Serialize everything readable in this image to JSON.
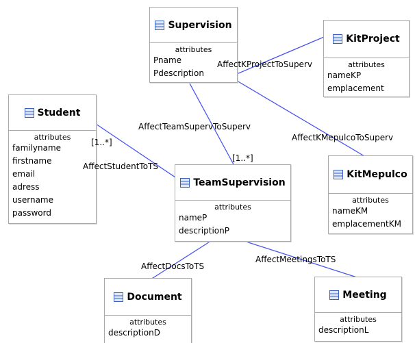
{
  "section_label": "attributes",
  "classes": {
    "supervision": {
      "name": "Supervision",
      "attributes": [
        "Pname",
        "Pdescription"
      ]
    },
    "kitproject": {
      "name": "KitProject",
      "attributes": [
        "nameKP",
        "emplacement"
      ]
    },
    "student": {
      "name": "Student",
      "attributes": [
        "familyname",
        "firstname",
        "email",
        "adress",
        "username",
        "password"
      ]
    },
    "teamsupervision": {
      "name": "TeamSupervision",
      "attributes": [
        "nameP",
        "descriptionP"
      ]
    },
    "kitmepulco": {
      "name": "KitMepulco",
      "attributes": [
        "nameKM",
        "emplacementKM"
      ]
    },
    "document": {
      "name": "Document",
      "attributes": [
        "descriptionD"
      ]
    },
    "meeting": {
      "name": "Meeting",
      "attributes": [
        "descriptionL"
      ]
    }
  },
  "associations": {
    "kitproject_to_superv": "AffectKProjectToSuperv",
    "teamsuperv_to_superv": "AffectTeamSupervToSuperv",
    "kitmepulco_to_superv": "AffectKMepulcoToSuperv",
    "student_to_ts": "AffectStudentToTS",
    "docs_to_ts": "AffectDocsToTS",
    "meetings_to_ts": "AffectMeetingsToTS"
  },
  "multiplicities": {
    "student_end": "[1..*]",
    "teamsupervision_end": "[1..*]"
  },
  "colors": {
    "link": "#4a55f0",
    "icon_stroke": "#3a5fbf",
    "icon_fill": "#dfe8f8",
    "border": "#a9a9a9"
  }
}
